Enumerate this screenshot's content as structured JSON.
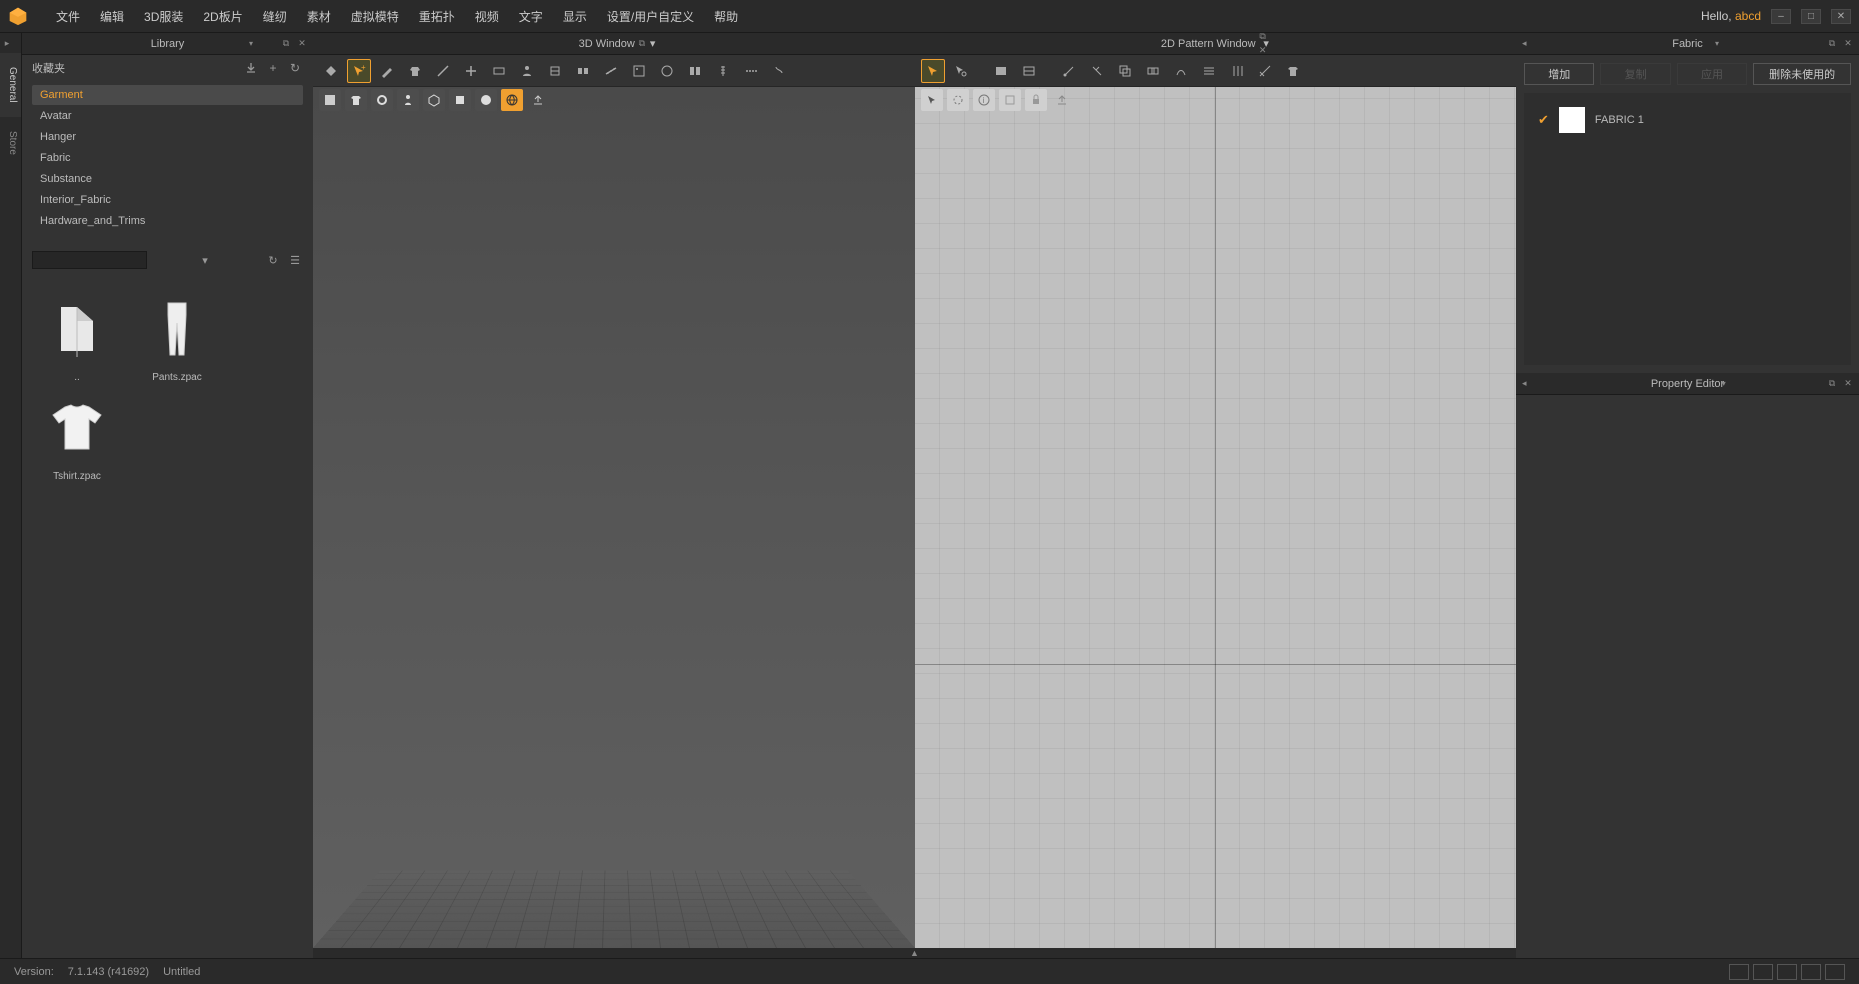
{
  "topbar": {
    "menus": [
      "文件",
      "编辑",
      "3D服装",
      "2D板片",
      "缝纫",
      "素材",
      "虚拟模特",
      "重拓扑",
      "视频",
      "文字",
      "显示",
      "设置/用户自定义",
      "帮助"
    ],
    "hello_prefix": "Hello, ",
    "username": "abcd"
  },
  "sidetabs": {
    "general": "General",
    "store": "Store"
  },
  "library": {
    "title": "Library",
    "fav_label": "收藏夹",
    "tree": [
      "Garment",
      "Avatar",
      "Hanger",
      "Fabric",
      "Substance",
      "Interior_Fabric",
      "Hardware_and_Trims"
    ],
    "selected_index": 0,
    "thumbs": [
      {
        "name": "..",
        "type": "folder"
      },
      {
        "name": "Pants.zpac",
        "type": "pants"
      },
      {
        "name": "Tshirt.zpac",
        "type": "tshirt"
      }
    ]
  },
  "window3d": {
    "title": "3D Window"
  },
  "window2d": {
    "title": "2D Pattern Window"
  },
  "fabric": {
    "title": "Fabric",
    "btn_add": "增加",
    "btn_copy": "复制",
    "btn_apply": "应用",
    "btn_delete": "删除未使用的",
    "items": [
      {
        "name": "FABRIC 1"
      }
    ]
  },
  "property": {
    "title": "Property Editor"
  },
  "status": {
    "version_label": "Version:",
    "version": "7.1.143 (r41692)",
    "file": "Untitled"
  }
}
